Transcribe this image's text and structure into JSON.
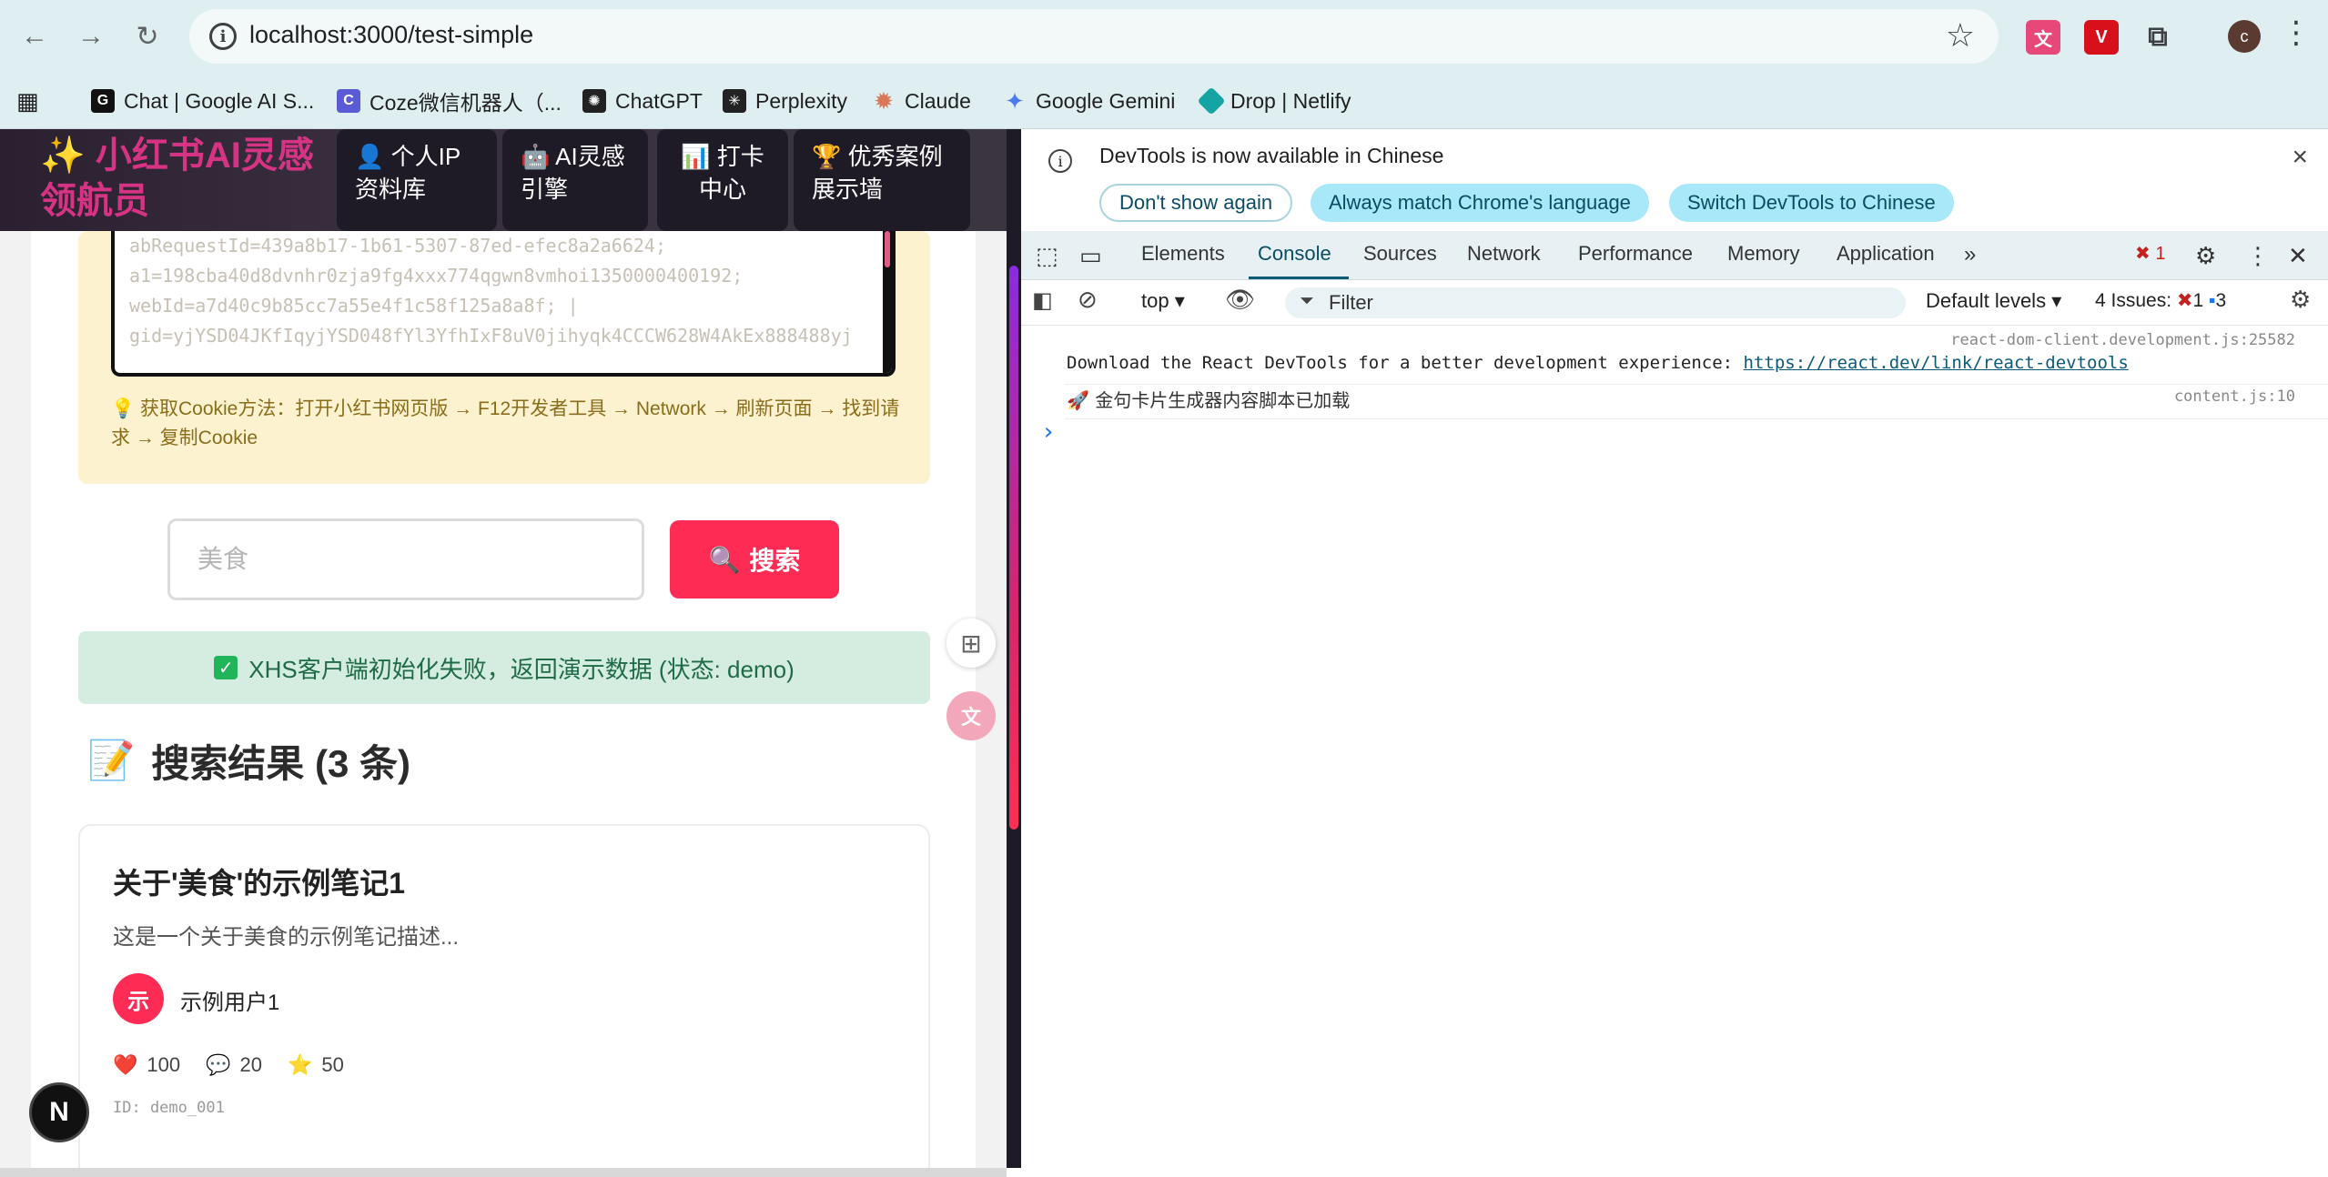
{
  "browser": {
    "url": "localhost:3000/test-simple",
    "bookmarks": [
      {
        "label": "Chat | Google AI S...",
        "icon": "google-ai-icon",
        "color": "#111111"
      },
      {
        "label": "Coze微信机器人（...",
        "icon": "coze-icon",
        "color": "#5b5bd6"
      },
      {
        "label": "ChatGPT",
        "icon": "chatgpt-icon",
        "color": "#222222"
      },
      {
        "label": "Perplexity",
        "icon": "perplexity-icon",
        "color": "#222222"
      },
      {
        "label": "Claude",
        "icon": "claude-icon",
        "color": "#d97757"
      },
      {
        "label": "Google Gemini",
        "icon": "gemini-icon",
        "color": "#4a7cf0"
      },
      {
        "label": "Drop | Netlify",
        "icon": "netlify-icon",
        "color": "#16a3a3"
      }
    ],
    "profile_initial": "c"
  },
  "app": {
    "brand": "✨ 小红书AI灵感领航员",
    "nav": [
      {
        "label": "👤 个人IP资料库"
      },
      {
        "label": "🤖 AI灵感引擎"
      },
      {
        "label": "📊 打卡中心"
      },
      {
        "label": "🏆 优秀案例展示墙"
      }
    ],
    "cookie_lines": [
      "abRequestId=439a8b17-1b61-5307-87ed-efec8a2a6624;",
      "a1=198cba40d8dvnhr0zja9fg4xxx774qgwn8vmhoi1350000400192;",
      "webId=a7d40c9b85cc7a55e4f1c58f125a8a8f; |",
      "gid=yjYSD04JKfIqyjYSD048fYl3YfhIxF8uV0jihyqk4CCCW628W4AkEx888488yj"
    ],
    "cookie_tip": "💡 获取Cookie方法：打开小红书网页版 → F12开发者工具 → Network → 刷新页面 → 找到请求 → 复制Cookie",
    "search": {
      "placeholder": "美食",
      "button": "搜索"
    },
    "status": "XHS客户端初始化失败，返回演示数据 (状态: demo)",
    "results_title": "搜索结果 (3 条)",
    "note": {
      "title": "关于'美食'的示例笔记1",
      "desc": "这是一个关于美食的示例笔记描述...",
      "avatar": "示",
      "user": "示例用户1",
      "likes": "100",
      "comments": "20",
      "stars": "50",
      "id": "ID: demo_001"
    },
    "next_badge": "N"
  },
  "devtools": {
    "banner": "DevTools is now available in Chinese",
    "pills": [
      "Don't show again",
      "Always match Chrome's language",
      "Switch DevTools to Chinese"
    ],
    "tabs": [
      "Elements",
      "Console",
      "Sources",
      "Network",
      "Performance",
      "Memory",
      "Application"
    ],
    "active_tab": "Console",
    "error_count": "1",
    "context": "top",
    "filter_placeholder": "Filter",
    "levels": "Default levels",
    "issues_label": "4 Issues:",
    "issues_errors": "1",
    "issues_info": "3",
    "messages": [
      {
        "text": "Download the React DevTools for a better development experience: ",
        "link": "https://react.dev/link/react-devtools",
        "source": "react-dom-client.development.js:25582"
      },
      {
        "text": "🚀 金句卡片生成器内容脚本已加载",
        "source": "content.js:10"
      }
    ],
    "prompt": "›"
  },
  "colors": {
    "chrome_bg": "#dfeef0",
    "brand_pink": "#d63384",
    "search_red": "#fe2c55",
    "status_green": "#d5ede0",
    "pill_bg": "#a8e8f8"
  }
}
